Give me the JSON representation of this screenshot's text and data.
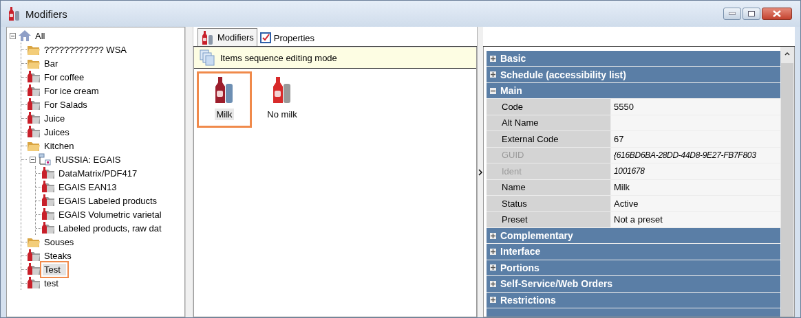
{
  "window": {
    "title": "Modifiers"
  },
  "tree": [
    {
      "label": "All",
      "kind": "root",
      "selected": false,
      "expanded": true,
      "children": [
        {
          "label": "???????????? WSA",
          "kind": "folder",
          "selected": false
        },
        {
          "label": "Bar",
          "kind": "folder",
          "selected": false
        },
        {
          "label": "For coffee",
          "kind": "modifier-folder",
          "selected": false
        },
        {
          "label": "For ice cream",
          "kind": "modifier-folder",
          "selected": false
        },
        {
          "label": "For Salads",
          "kind": "modifier-folder",
          "selected": false
        },
        {
          "label": "Juice",
          "kind": "modifier-folder",
          "selected": false
        },
        {
          "label": "Juices",
          "kind": "modifier-folder",
          "selected": false
        },
        {
          "label": "Kitchen",
          "kind": "folder",
          "selected": false
        },
        {
          "label": "RUSSIA: EGAIS",
          "kind": "group",
          "selected": false,
          "expanded": true,
          "children": [
            {
              "label": "DataMatrix/PDF417",
              "kind": "modifier-folder",
              "selected": false
            },
            {
              "label": "EGAIS EAN13",
              "kind": "modifier-folder",
              "selected": false
            },
            {
              "label": "EGAIS Labeled products",
              "kind": "modifier-folder",
              "selected": false
            },
            {
              "label": "EGAIS Volumetric varietal",
              "kind": "modifier-folder",
              "selected": false
            },
            {
              "label": "Labeled products, raw dat",
              "kind": "modifier-folder",
              "selected": false
            }
          ]
        },
        {
          "label": "Souses",
          "kind": "folder",
          "selected": false
        },
        {
          "label": "Steaks",
          "kind": "modifier-folder",
          "selected": false
        },
        {
          "label": "Test",
          "kind": "modifier-folder",
          "selected": true
        },
        {
          "label": "test",
          "kind": "modifier-folder",
          "selected": false
        }
      ]
    }
  ],
  "tabs": [
    {
      "label": "Modifiers",
      "selected": true
    },
    {
      "label": "Properties",
      "selected": false
    }
  ],
  "mode_bar": {
    "text": "Items sequence editing mode"
  },
  "items": [
    {
      "label": "Milk",
      "selected": true
    },
    {
      "label": "No milk",
      "selected": false
    }
  ],
  "property_grid": [
    {
      "title": "Basic",
      "expanded": false
    },
    {
      "title": "Schedule (accessibility list)",
      "expanded": false
    },
    {
      "title": "Main",
      "expanded": true,
      "rows": [
        {
          "name": "Code",
          "value": "5550",
          "disabled": false
        },
        {
          "name": "Alt Name",
          "disabled": false
        },
        {
          "name": "External Code",
          "value": "67",
          "disabled": false
        },
        {
          "name": "GUID",
          "value": "{616BD6BA-28DD-44D8-9E27-FB7F803",
          "disabled": true
        },
        {
          "name": "Ident",
          "value": "1001678",
          "disabled": true
        },
        {
          "name": "Name",
          "value": "Milk",
          "disabled": false
        },
        {
          "name": "Status",
          "value": "Active",
          "disabled": false
        },
        {
          "name": "Preset",
          "value": "Not a preset",
          "disabled": false
        }
      ]
    },
    {
      "title": "Complementary",
      "expanded": false
    },
    {
      "title": "Interface",
      "expanded": false
    },
    {
      "title": "Portions",
      "expanded": false
    },
    {
      "title": "Self-Service/Web Orders",
      "expanded": false
    },
    {
      "title": "Restrictions",
      "expanded": false
    }
  ]
}
